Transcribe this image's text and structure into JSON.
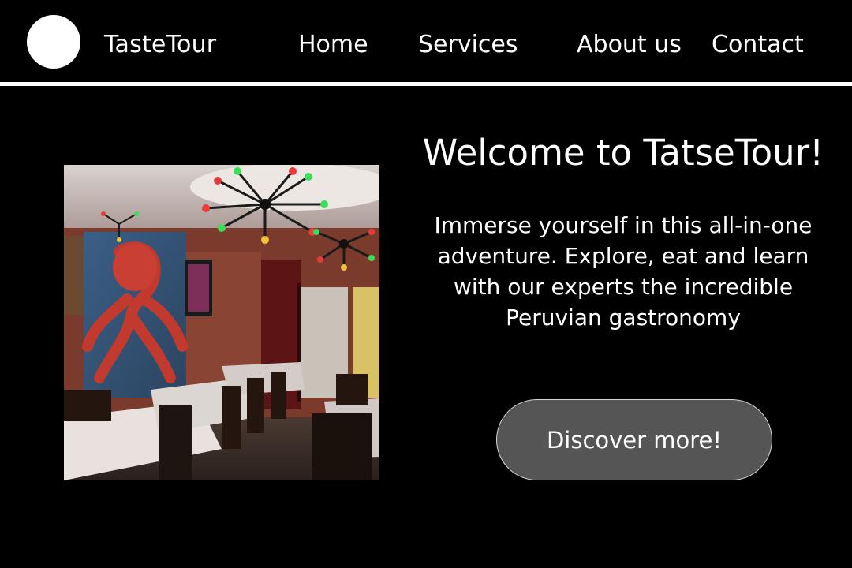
{
  "header": {
    "brand": "TasteTour",
    "nav": {
      "home": "Home",
      "services": "Services",
      "about": "About us",
      "contact": "Contact"
    }
  },
  "hero": {
    "title": "Welcome to TatseTour!",
    "description": "Immerse yourself in this all-in-one adventure. Explore, eat and learn with our experts the incredible Peruvian gastronomy",
    "cta_label": "Discover more!"
  },
  "colors": {
    "background": "#000000",
    "text": "#ffffff",
    "button": "#555555",
    "divider": "#ffffff"
  }
}
